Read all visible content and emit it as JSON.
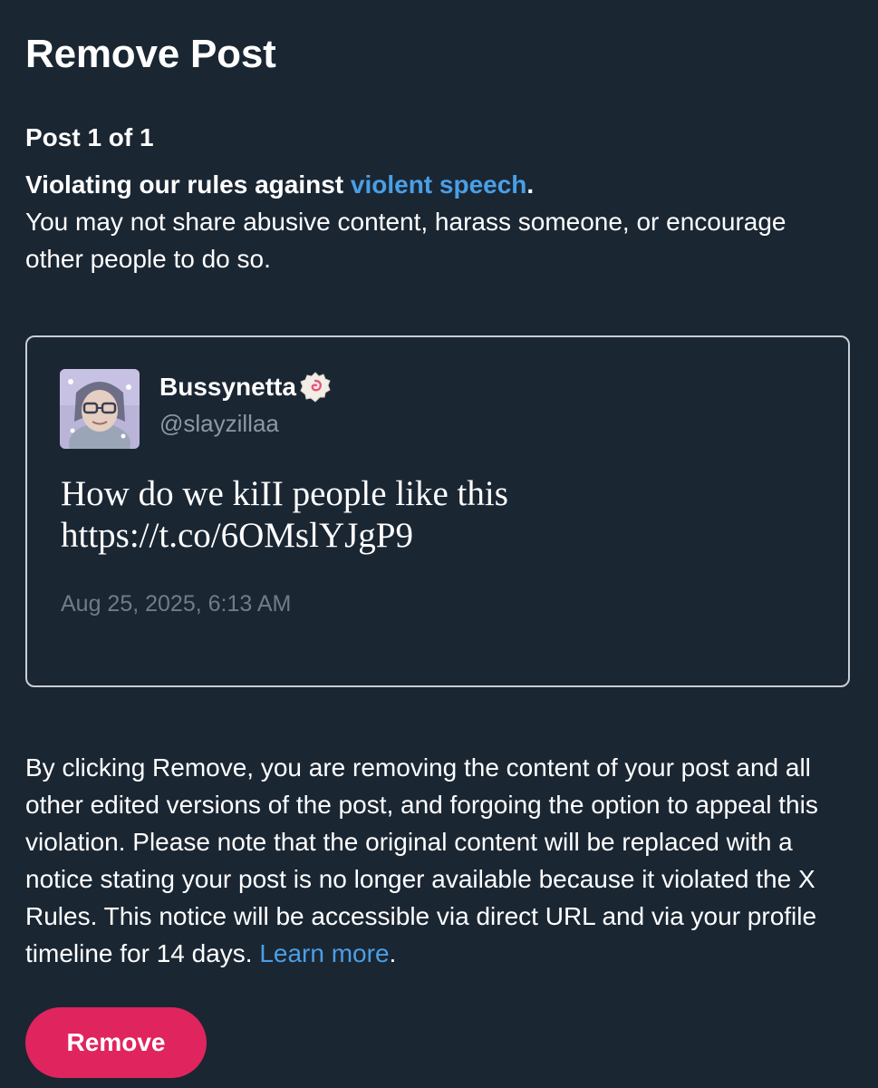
{
  "header": {
    "title": "Remove Post"
  },
  "post_counter": "Post 1 of 1",
  "violation": {
    "rule_prefix": "Violating our rules against ",
    "rule_link": "violent speech",
    "rule_suffix": ".",
    "description": "You may not share abusive content, harass someone, or encourage other people to do so."
  },
  "post": {
    "display_name": "Bussynetta",
    "badge_icon": "narutomaki-emoji-icon",
    "handle": "@slayzillaa",
    "text_line1": "How do we kiII people like this",
    "text_line2": "https://t.co/6OMslYJgP9",
    "timestamp": "Aug 25, 2025, 6:13 AM"
  },
  "notice": {
    "text": "By clicking Remove, you are removing the content of your post and all other edited versions of the post, and forgoing the option to appeal this violation. Please note that the original content will be replaced with a notice stating your post is no longer available because it violated the X Rules. This notice will be accessible via direct URL and via your profile timeline for 14 days. ",
    "learn_more": "Learn more",
    "suffix": "."
  },
  "actions": {
    "remove_label": "Remove"
  },
  "colors": {
    "background": "#1b2633",
    "link": "#4a9fe6",
    "remove_button": "#e0245e",
    "muted_text": "#8b98a5",
    "card_border": "#c9ced4"
  }
}
